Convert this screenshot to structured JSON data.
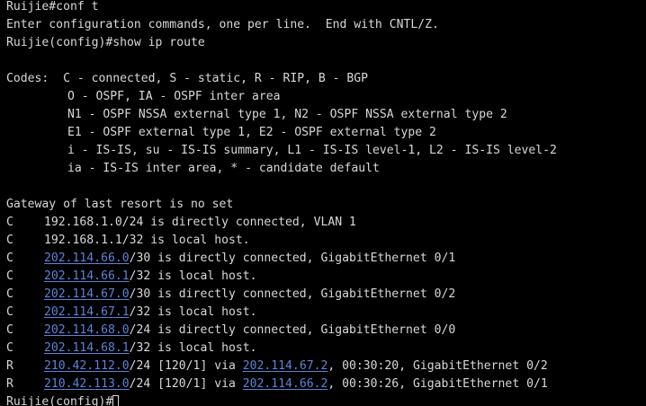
{
  "terminal": {
    "header": [
      "Ruijie#conf t",
      "Enter configuration commands, one per line.  End with CNTL/Z.",
      "Ruijie(config)#show ip route"
    ],
    "codes": {
      "prefix": "Codes:  ",
      "lines": [
        "C - connected, S - static, R - RIP, B - BGP",
        "O - OSPF, IA - OSPF inter area",
        "N1 - OSPF NSSA external type 1, N2 - OSPF NSSA external type 2",
        "E1 - OSPF external type 1, E2 - OSPF external type 2",
        "i - IS-IS, su - IS-IS summary, L1 - IS-IS level-1, L2 - IS-IS level-2",
        "ia - IS-IS inter area, * - candidate default"
      ]
    },
    "gateway": "Gateway of last resort is no set",
    "routes": [
      {
        "code": "C",
        "network": "192.168.1.0",
        "network_link": false,
        "rest": "/24 is directly connected, VLAN 1"
      },
      {
        "code": "C",
        "network": "192.168.1.1",
        "network_link": false,
        "rest": "/32 is local host."
      },
      {
        "code": "C",
        "network": "202.114.66.0",
        "network_link": true,
        "rest": "/30 is directly connected, GigabitEthernet 0/1"
      },
      {
        "code": "C",
        "network": "202.114.66.1",
        "network_link": true,
        "rest": "/32 is local host."
      },
      {
        "code": "C",
        "network": "202.114.67.0",
        "network_link": true,
        "rest": "/30 is directly connected, GigabitEthernet 0/2"
      },
      {
        "code": "C",
        "network": "202.114.67.1",
        "network_link": true,
        "rest": "/32 is local host."
      },
      {
        "code": "C",
        "network": "202.114.68.0",
        "network_link": true,
        "rest": "/24 is directly connected, GigabitEthernet 0/0"
      },
      {
        "code": "C",
        "network": "202.114.68.1",
        "network_link": true,
        "rest": "/32 is local host."
      },
      {
        "code": "R",
        "network": "210.42.112.0",
        "network_link": true,
        "rest": "/24 [120/1] via ",
        "via": "202.114.67.2",
        "tail": ", 00:30:20, GigabitEthernet 0/2"
      },
      {
        "code": "R",
        "network": "210.42.113.0",
        "network_link": true,
        "rest": "/24 [120/1] via ",
        "via": "202.114.66.2",
        "tail": ", 00:30:26, GigabitEthernet 0/1"
      }
    ],
    "prompt": "Ruijie(config)#"
  },
  "colors": {
    "background": "#000000",
    "text": "#d8d8d8",
    "link": "#5b84d6"
  }
}
